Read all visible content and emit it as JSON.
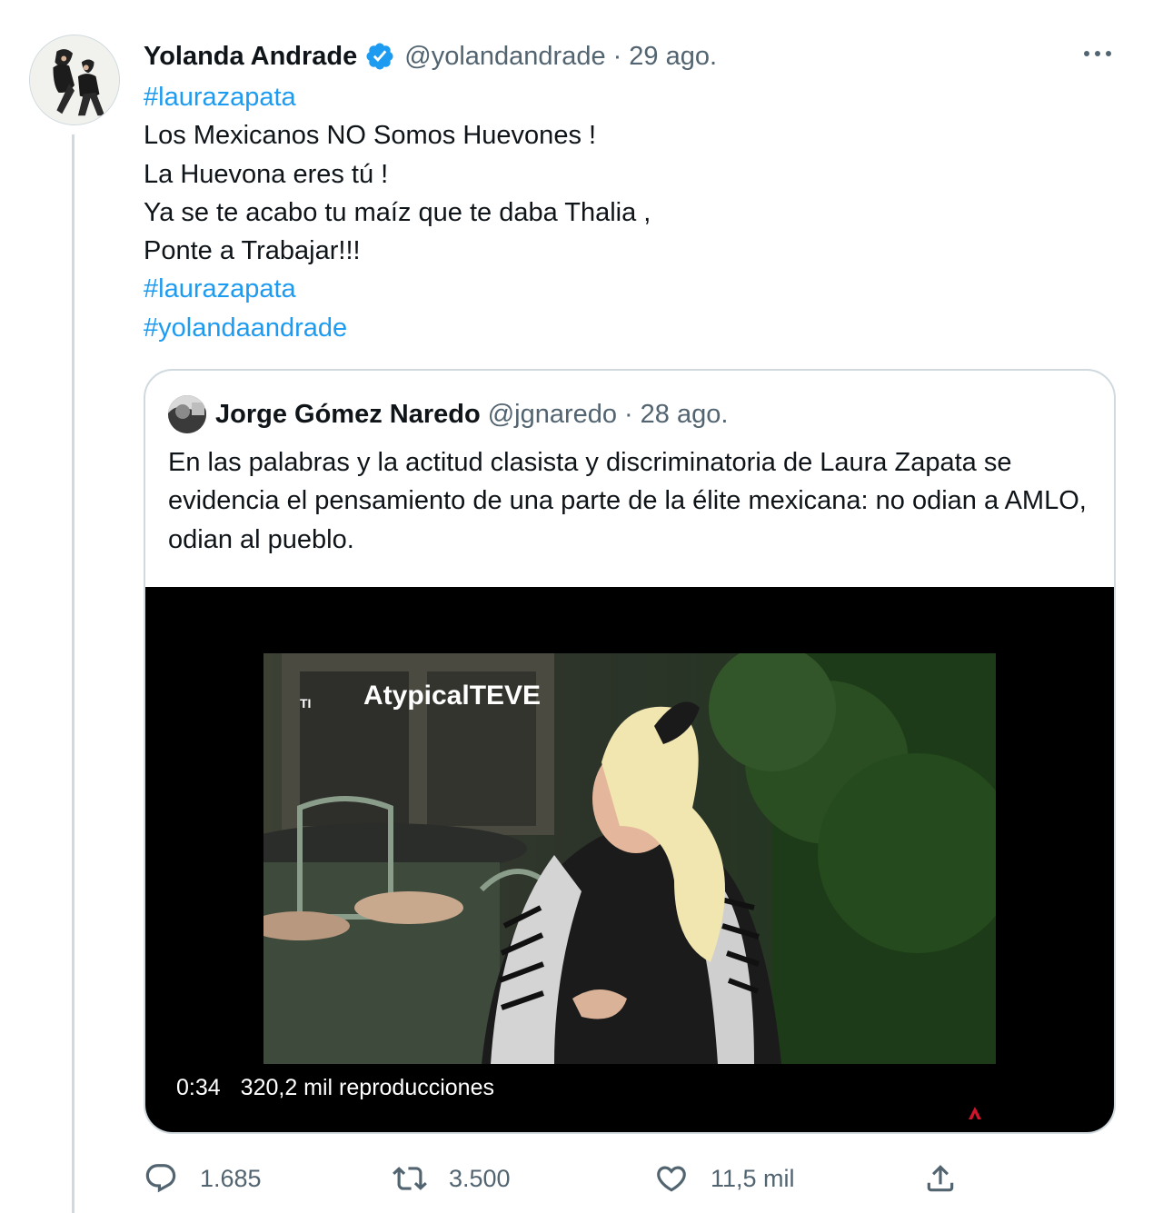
{
  "tweet": {
    "author_name": "Yolanda Andrade",
    "handle": "@yolandandrade",
    "separator": "·",
    "date": "29 ago.",
    "lines": [
      "#laurazapata",
      "Los Mexicanos NO Somos Huevones !",
      "La Huevona eres tú !",
      "Ya se te acabo tu maíz que te daba Thalia ,",
      "Ponte a Trabajar!!!",
      "#laurazapata",
      "#yolandaandrade"
    ]
  },
  "quoted": {
    "author_name": "Jorge Gómez Naredo",
    "handle": "@jgnaredo",
    "separator": "·",
    "date": "28 ago.",
    "text": "En las palabras y la actitud clasista y discriminatoria de Laura Zapata se evidencia el pensamiento de una parte de la élite mexicana: no odian a AMLO, odian al pueblo.",
    "video": {
      "duration": "0:34",
      "views": "320,2 mil reproducciones",
      "watermark": "AtypicalTEVE",
      "corner_mark": "TI"
    }
  },
  "actions": {
    "reply_count": "1.685",
    "retweet_count": "3.500",
    "like_count": "11,5 mil"
  },
  "icons": {
    "verified": "verified-badge-icon",
    "more": "more-icon",
    "reply": "reply-icon",
    "retweet": "retweet-icon",
    "like": "heart-icon",
    "share": "share-icon"
  },
  "colors": {
    "link": "#1d9bf0",
    "secondary_text": "#536471",
    "border": "#cfd9de"
  }
}
